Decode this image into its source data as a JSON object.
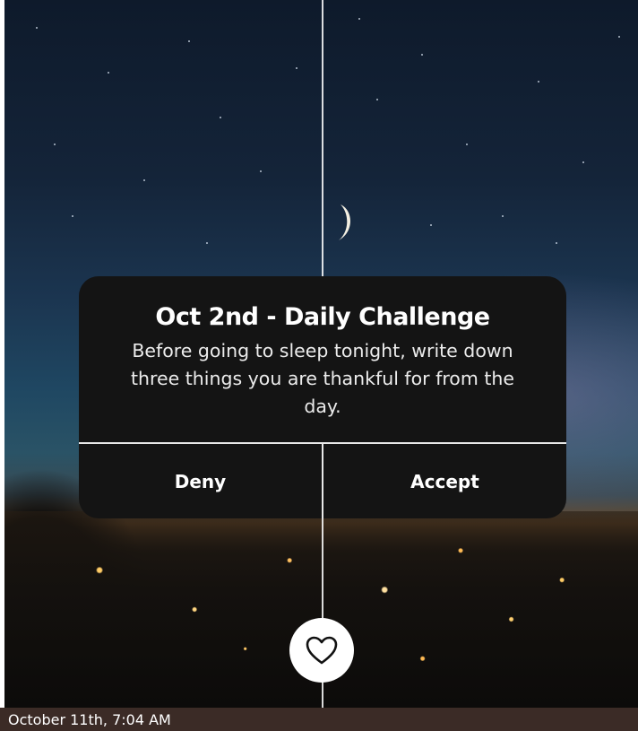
{
  "dialog": {
    "title": "Oct 2nd - Daily Challenge",
    "body": "Before going to sleep tonight, write down three things you are thankful for from the day.",
    "deny_label": "Deny",
    "accept_label": "Accept"
  },
  "footer": {
    "timestamp": "October 11th, 7:04 AM"
  },
  "icons": {
    "heart": "heart-icon",
    "moon": "moon-icon"
  },
  "colors": {
    "dialog_bg": "#141414",
    "footer_bg": "#3b2b26",
    "sky_top": "#0e1a2b",
    "heart_button_bg": "#ffffff"
  }
}
